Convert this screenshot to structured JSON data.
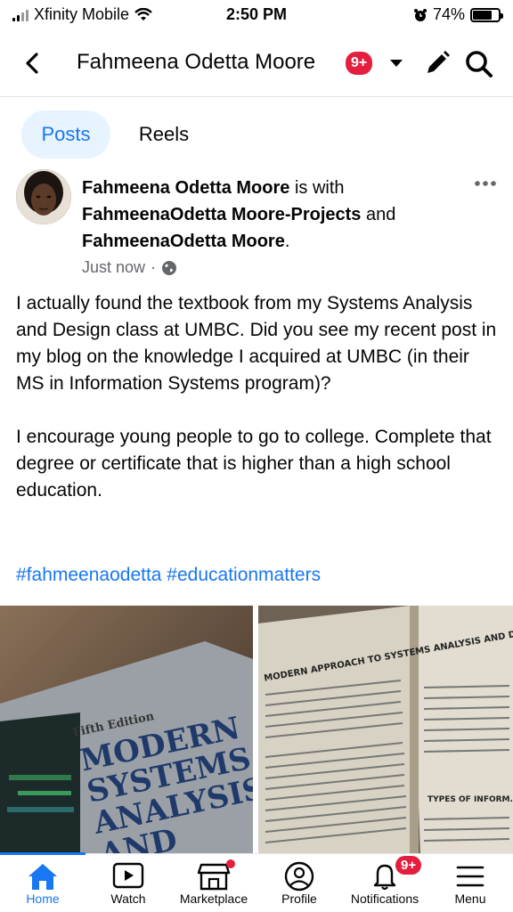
{
  "status_bar": {
    "carrier": "Xfinity Mobile",
    "time": "2:50 PM",
    "battery": "74%"
  },
  "header": {
    "title": "Fahmeena Odetta Moore",
    "badge": "9+"
  },
  "tabs": [
    {
      "label": "Posts",
      "active": true
    },
    {
      "label": "Reels",
      "active": false
    }
  ],
  "post": {
    "author": "Fahmeena Odetta Moore",
    "is_with": " is with ",
    "tagged_1": "FahmeenaOdetta Moore-Projects",
    "and": " and ",
    "tagged_2": "FahmeenaOdetta Moore",
    "period": ".",
    "time": "Just now",
    "paragraph_1": "I actually found the textbook from my Systems Analysis and Design class at UMBC. Did you see my recent post in my blog on the knowledge I acquired at UMBC (in their MS in Information Systems program)?",
    "paragraph_2": "I encourage young people to go to college. Complete that degree or certificate that is higher than a high school education.",
    "hashtags": "#fahmeenaodetta #educationmatters"
  },
  "photos": {
    "left": {
      "edition": "Fifth Edition",
      "title_lines": [
        "MODERN",
        "SYSTEMS",
        "ANALYSIS",
        "AND"
      ]
    },
    "right": {
      "heading": "MODERN APPROACH TO SYSTEMS ANALYSIS AND DESIGN",
      "side_heading": "TYPES OF INFORM... AND SYSTEMS DE..."
    }
  },
  "bottom_nav": [
    {
      "label": "Home",
      "active": true
    },
    {
      "label": "Watch"
    },
    {
      "label": "Marketplace"
    },
    {
      "label": "Profile"
    },
    {
      "label": "Notifications",
      "badge": "9+"
    },
    {
      "label": "Menu"
    }
  ],
  "colors": {
    "accent": "#1877f2",
    "badge": "#e41e3f",
    "muted": "#65676b"
  }
}
